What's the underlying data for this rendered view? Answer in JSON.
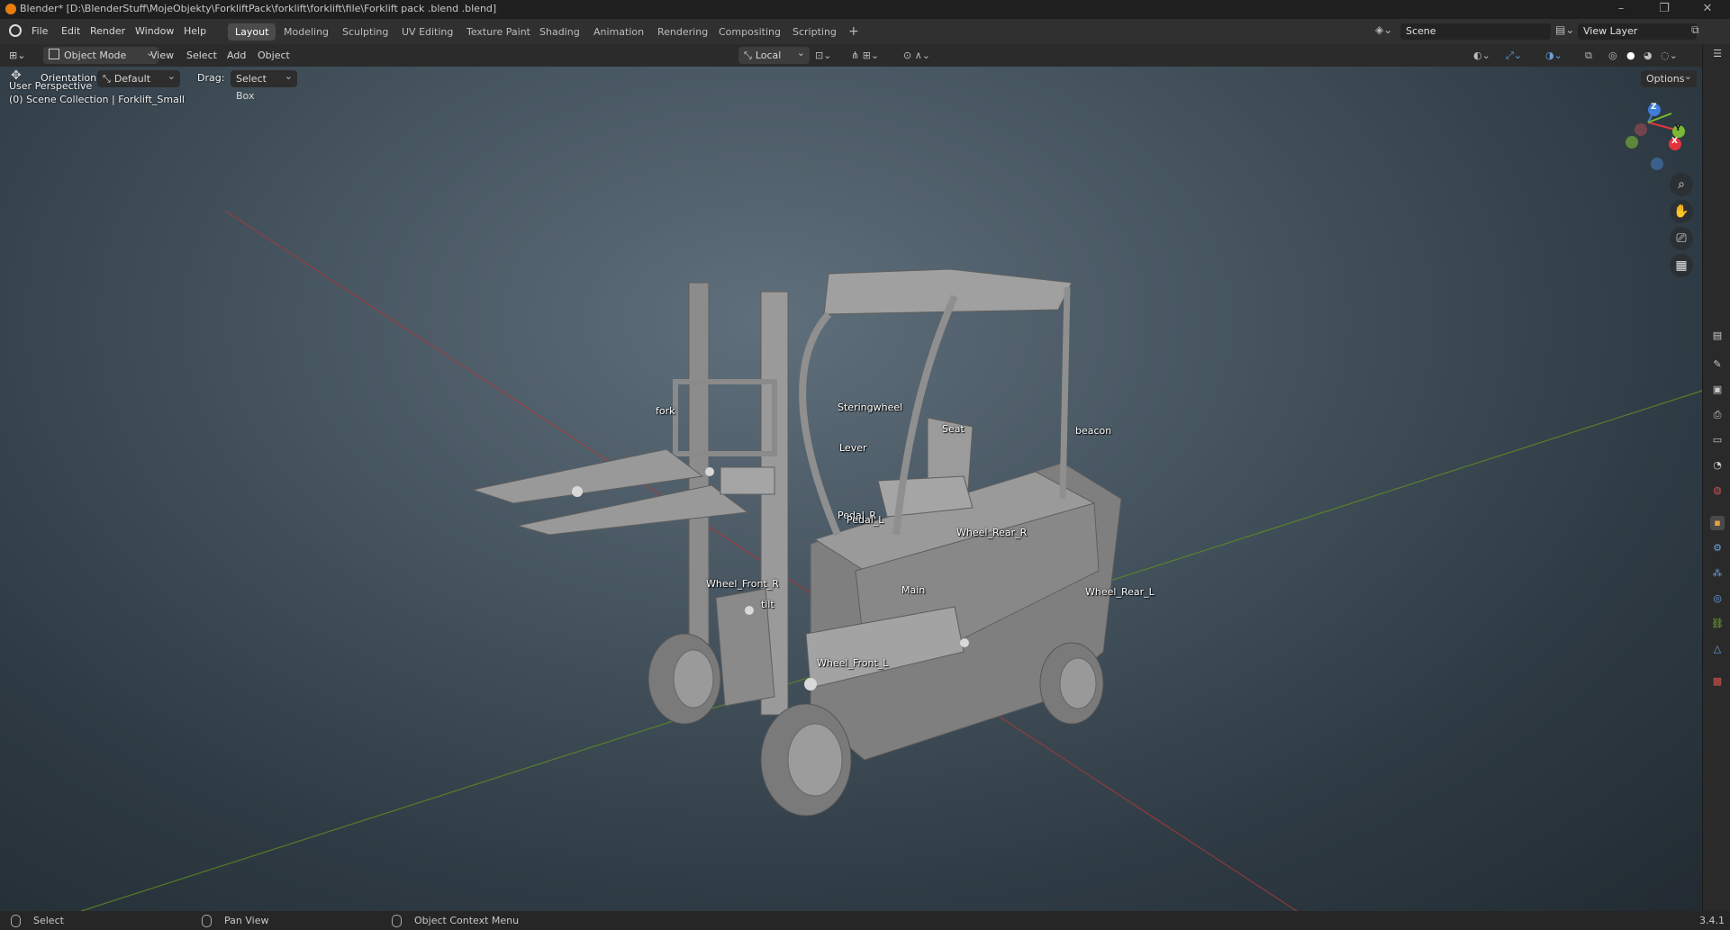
{
  "titlebar": {
    "title": "Blender* [D:\\BlenderStuff\\MojeObjekty\\ForkliftPack\\forklift\\forklift\\file\\Forklift pack .blend .blend]",
    "minimize": "–",
    "maximize": "❐",
    "close": "✕"
  },
  "menubar": {
    "items": [
      "File",
      "Edit",
      "Render",
      "Window",
      "Help"
    ]
  },
  "workspaces": [
    "Layout",
    "Modeling",
    "Sculpting",
    "UV Editing",
    "Texture Paint",
    "Shading",
    "Animation",
    "Rendering",
    "Compositing",
    "Scripting"
  ],
  "add_workspace": "+",
  "scene": {
    "name": "Scene"
  },
  "view_layer": {
    "name": "View Layer"
  },
  "header": {
    "mode": "Object Mode",
    "menus": [
      "View",
      "Select",
      "Add",
      "Object"
    ],
    "transform_orientation": "Local",
    "options_label": "Options"
  },
  "toolsettings": {
    "orientation_label": "Orientation:",
    "orientation_value": "Default",
    "drag_label": "Drag:",
    "drag_value": "Select Box"
  },
  "viewport": {
    "view_name": "User Perspective",
    "collection_info": "(0) Scene Collection | Forklift_Small",
    "gizmo_axes": {
      "z": "Z",
      "y": "Y",
      "x": "X"
    }
  },
  "object_labels": {
    "fork": "fork",
    "steeringwheel": "Steringwheel",
    "seat": "Seat",
    "beacon": "beacon",
    "lever": "Lever",
    "pedal_r": "Pedal_R",
    "pedal_l": "Pedal_L",
    "wheel_rear_r": "Wheel_Rear_R",
    "wheel_front_r": "Wheel_Front_R",
    "tilt": "tilt",
    "main": "Main",
    "wheel_rear_l": "Wheel_Rear_L",
    "wheel_front_l": "Wheel_Front_L"
  },
  "statusbar": {
    "select": "Select",
    "pan_view": "Pan View",
    "context_menu": "Object Context Menu",
    "version": "3.4.1"
  },
  "colors": {
    "accent": "#e87d0d",
    "grid_x_axis": "#b23b3b",
    "grid_y_axis": "#6a9a2a",
    "gizmo_x": "#e0353f",
    "gizmo_y": "#7ab835",
    "gizmo_z": "#3f7ed8"
  }
}
